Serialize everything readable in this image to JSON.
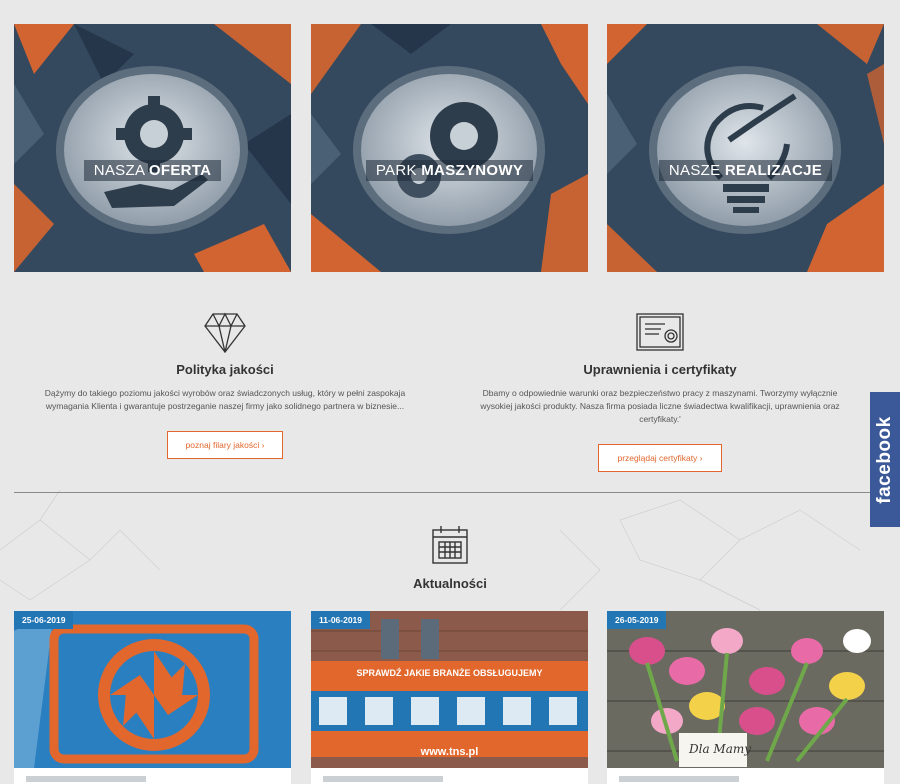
{
  "tiles": [
    {
      "label_light": "NASZA",
      "label_bold": "OFERTA",
      "icon": "gear-hand-icon"
    },
    {
      "label_light": "PARK",
      "label_bold": "MASZYNOWY",
      "icon": "gears-icon"
    },
    {
      "label_light": "NASZE",
      "label_bold": "REALIZACJE",
      "icon": "lightbulb-arrows-icon"
    }
  ],
  "features": [
    {
      "icon": "diamond-icon",
      "title": "Polityka jakości",
      "text": "Dążymy do takiego poziomu jakości wyrobów oraz świadczonych usług, który w pełni zaspokaja wymagania Klienta i gwarantuje postrzeganie naszej firmy jako solidnego partnera w biznesie...",
      "button": "poznaj filary jakości  ›"
    },
    {
      "icon": "certificate-icon",
      "title": "Uprawnienia i certyfikaty",
      "text": "Dbamy o odpowiednie warunki oraz bezpieczeństwo pracy z maszynami. Tworzymy wyłącznie wysokiej jakości produkty. Nasza firma posiada liczne świadectwa kwalifikacji, uprawnienia oraz certyfikaty.'",
      "button": "przeglądaj certyfikaty  ›"
    }
  ],
  "news": {
    "icon": "calendar-icon",
    "heading": "Aktualności",
    "cards": [
      {
        "date": "25-06-2019"
      },
      {
        "date": "11-06-2019",
        "banner": "SPRAWDŹ JAKIE BRANŻE OBSŁUGUJEMY",
        "url": "www.tns.pl"
      },
      {
        "date": "26-05-2019",
        "card_text": "Dla Mamy"
      }
    ]
  },
  "facebook": {
    "label": "facebook"
  },
  "colors": {
    "accent": "#e2672c",
    "navy": "#2f4256",
    "date_badge": "#2376b4",
    "facebook": "#3b5998"
  }
}
